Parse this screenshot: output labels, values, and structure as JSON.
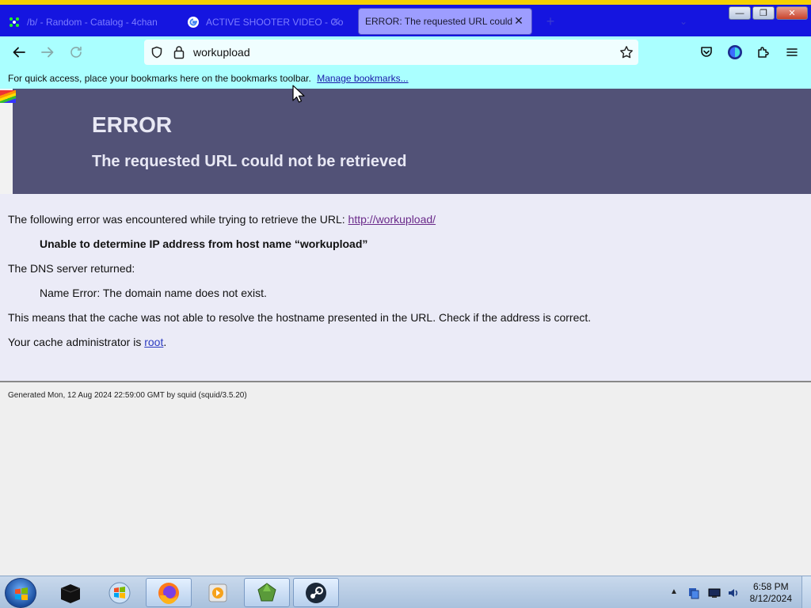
{
  "tabs": [
    {
      "title": "/b/ - Random - Catalog - 4chan",
      "favicon": "sparkle-icon",
      "active": false
    },
    {
      "title": "ACTIVE SHOOTER VIDEO - Go",
      "favicon": "google-icon",
      "active": false
    },
    {
      "title": "ERROR: The requested URL could n",
      "favicon": "",
      "active": true
    }
  ],
  "window_controls": {
    "minimize": "—",
    "maximize": "❐",
    "close": "✕"
  },
  "navbar": {
    "url": "workupload"
  },
  "bookmarks_bar": {
    "message": "For quick access, place your bookmarks here on the bookmarks toolbar.",
    "manage_link": "Manage bookmarks..."
  },
  "error_page": {
    "title": "ERROR",
    "subtitle": "The requested URL could not be retrieved",
    "line1_prefix": "The following error was encountered while trying to retrieve the URL: ",
    "line1_link": "http://workupload/",
    "detail": "Unable to determine IP address from host name “workupload”",
    "dns_label": "The DNS server returned:",
    "dns_result": "Name Error: The domain name does not exist.",
    "explanation": "This means that the cache was not able to resolve the hostname presented in the URL. Check if the address is correct.",
    "admin_prefix": "Your cache administrator is ",
    "admin_link": "root",
    "admin_suffix": ".",
    "footer": "Generated Mon, 12 Aug 2024 22:59:00 GMT by squid (squid/3.5.20)"
  },
  "taskbar": {
    "time": "6:58 PM",
    "date": "8/12/2024"
  },
  "colors": {
    "tab_strip": "#1515e0",
    "navbar": "#aaffff",
    "error_header": "#525277",
    "error_body": "#ebebf7"
  }
}
